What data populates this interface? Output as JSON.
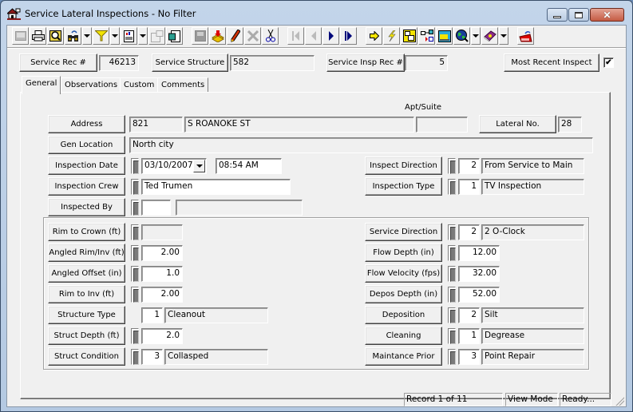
{
  "window": {
    "title": "Service Lateral Inspections - No Filter",
    "icon": "house-inspection-icon",
    "controls": [
      "minimize",
      "maximize",
      "close"
    ]
  },
  "toolbar": {
    "buttons": [
      {
        "name": "grid-view",
        "icon": "grid-icon",
        "enabled": false
      },
      {
        "name": "print",
        "icon": "printer-icon",
        "enabled": true
      },
      {
        "name": "print-preview",
        "icon": "magnifier-icon",
        "enabled": true
      },
      {
        "name": "find",
        "icon": "binoculars-icon",
        "enabled": true,
        "dropdown": true
      },
      {
        "name": "filter",
        "icon": "funnel-icon",
        "enabled": true,
        "dropdown": true
      },
      {
        "name": "report",
        "icon": "report-icon",
        "enabled": true,
        "dropdown": true
      },
      {
        "name": "properties",
        "icon": "properties-icon",
        "enabled": false
      },
      {
        "name": "export",
        "icon": "export-icon",
        "enabled": true
      },
      {
        "name": "save",
        "icon": "save-icon",
        "enabled": false
      },
      {
        "name": "add-record",
        "icon": "add-record-icon",
        "enabled": true
      },
      {
        "name": "edit",
        "icon": "pencil-icon",
        "enabled": true
      },
      {
        "name": "delete",
        "icon": "delete-x-icon",
        "enabled": false
      },
      {
        "name": "cut",
        "icon": "scissors-icon",
        "enabled": true
      },
      {
        "name": "first-record",
        "icon": "first-record-icon",
        "enabled": false
      },
      {
        "name": "previous-record",
        "icon": "previous-record-icon",
        "enabled": false
      },
      {
        "name": "next-record",
        "icon": "next-record-icon",
        "enabled": true
      },
      {
        "name": "last-record",
        "icon": "last-record-icon",
        "enabled": true
      },
      {
        "name": "go-to",
        "icon": "arrow-right-icon",
        "enabled": true
      },
      {
        "name": "quick-action",
        "icon": "lightning-icon",
        "enabled": true
      },
      {
        "name": "related-forms",
        "icon": "forms-icon",
        "enabled": true
      },
      {
        "name": "hierarchy",
        "icon": "hierarchy-icon",
        "enabled": true
      },
      {
        "name": "video",
        "icon": "video-icon",
        "enabled": true
      },
      {
        "name": "map",
        "icon": "globe-icon",
        "enabled": true,
        "dropdown": true
      },
      {
        "name": "help-book",
        "icon": "book-icon",
        "enabled": true,
        "dropdown": true
      },
      {
        "name": "exit",
        "icon": "exit-icon",
        "enabled": true
      }
    ]
  },
  "header": {
    "service_rec_label": "Service Rec #",
    "service_rec_value": "46213",
    "service_structure_label": "Service Structure",
    "service_structure_value": "582",
    "service_insp_rec_label": "Service Insp Rec #",
    "service_insp_rec_value": "5",
    "most_recent_label": "Most Recent Inspect",
    "most_recent_checked": "✔"
  },
  "tabs": [
    {
      "label": "General",
      "active": true
    },
    {
      "label": "Observations",
      "active": false
    },
    {
      "label": "Custom",
      "active": false
    },
    {
      "label": "Comments",
      "active": false
    }
  ],
  "general": {
    "apt_suite_label": "Apt/Suite",
    "address_label": "Address",
    "address_number": "821",
    "address_street": "S ROANOKE ST",
    "apt_suite_value": "",
    "lateral_no_label": "Lateral No.",
    "lateral_no_value": "28",
    "gen_location_label": "Gen Location",
    "gen_location_value": "North city",
    "inspection_date_label": "Inspection Date",
    "inspection_date_value": "03/10/2007",
    "inspection_time_value": "08:54 AM",
    "inspection_crew_label": "Inspection Crew",
    "inspection_crew_value": "Ted Trumen",
    "inspected_by_label": "Inspected By",
    "inspected_by_code": "",
    "inspected_by_desc": "",
    "inspect_direction_label": "Inspect Direction",
    "inspect_direction_code": "2",
    "inspect_direction_desc": "From Service to Main",
    "inspection_type_label": "Inspection Type",
    "inspection_type_code": "1",
    "inspection_type_desc": "TV Inspection"
  },
  "measurements": {
    "left": [
      {
        "label": "Rim to Crown (ft)",
        "value": ""
      },
      {
        "label": "Angled Rim/Inv (ft)",
        "value": "2.00"
      },
      {
        "label": "Angled Offset (in)",
        "value": "1.0"
      },
      {
        "label": "Rim to Inv (ft)",
        "value": "2.00"
      },
      {
        "label": "Structure Type",
        "code": "1",
        "desc": "Cleanout"
      },
      {
        "label": "Struct Depth (ft)",
        "value": "2.0"
      },
      {
        "label": "Struct Condition",
        "code": "3",
        "desc": "Collasped"
      }
    ],
    "right": [
      {
        "label": "Service Direction",
        "code": "2",
        "desc": "2 O-Clock"
      },
      {
        "label": "Flow Depth (in)",
        "value": "12.00"
      },
      {
        "label": "Flow Velocity (fps)",
        "value": "32.00"
      },
      {
        "label": "Depos Depth (in)",
        "value": "52.00"
      },
      {
        "label": "Deposition",
        "code": "2",
        "desc": "Silt"
      },
      {
        "label": "Cleaning",
        "code": "1",
        "desc": "Degrease"
      },
      {
        "label": "Maintance Prior",
        "code": "3",
        "desc": "Point Repair"
      }
    ]
  },
  "status": {
    "record": "Record 1 of 11",
    "mode": "View Mode",
    "state": "Ready..."
  }
}
